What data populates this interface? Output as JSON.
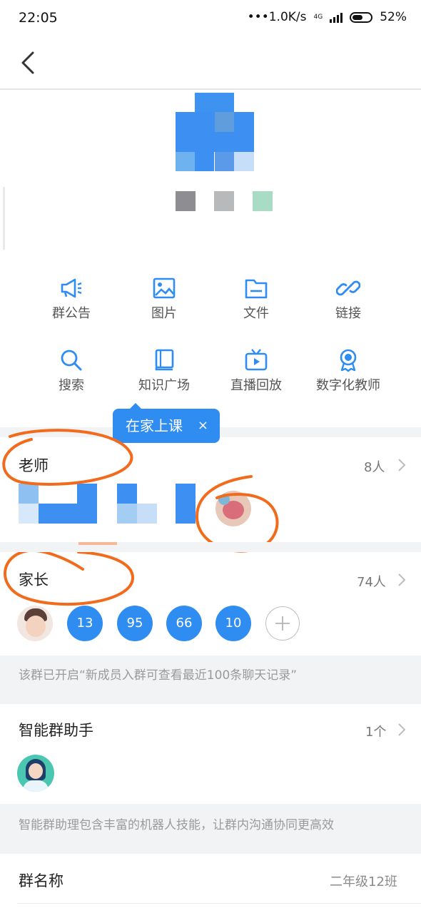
{
  "status": {
    "time": "22:05",
    "speed": "•••1.0K/s",
    "net": "4G",
    "battery": "52%"
  },
  "colors": {
    "accent": "#2f8df2",
    "annotation": "#f26b1d"
  },
  "actions": [
    {
      "label": "群公告",
      "icon": "megaphone-icon"
    },
    {
      "label": "图片",
      "icon": "image-icon"
    },
    {
      "label": "文件",
      "icon": "folder-icon"
    },
    {
      "label": "链接",
      "icon": "link-icon"
    },
    {
      "label": "搜索",
      "icon": "search-icon"
    },
    {
      "label": "知识广场",
      "icon": "book-icon"
    },
    {
      "label": "直播回放",
      "icon": "tv-play-icon"
    },
    {
      "label": "数字化教师",
      "icon": "badge-icon"
    }
  ],
  "tooltip": {
    "label": "在家上课",
    "close": "×"
  },
  "teachers": {
    "title": "老师",
    "count": "8人"
  },
  "parents": {
    "title": "家长",
    "count": "74人",
    "numbers": [
      "13",
      "95",
      "66",
      "10"
    ]
  },
  "history_note": "该群已开启“新成员入群可查看最近100条聊天记录”",
  "assistant": {
    "title": "智能群助手",
    "count": "1个",
    "note": "智能群助理包含丰富的机器人技能，让群内沟通协同更高效"
  },
  "group_name": {
    "label": "群名称",
    "value": "二年级12班"
  }
}
